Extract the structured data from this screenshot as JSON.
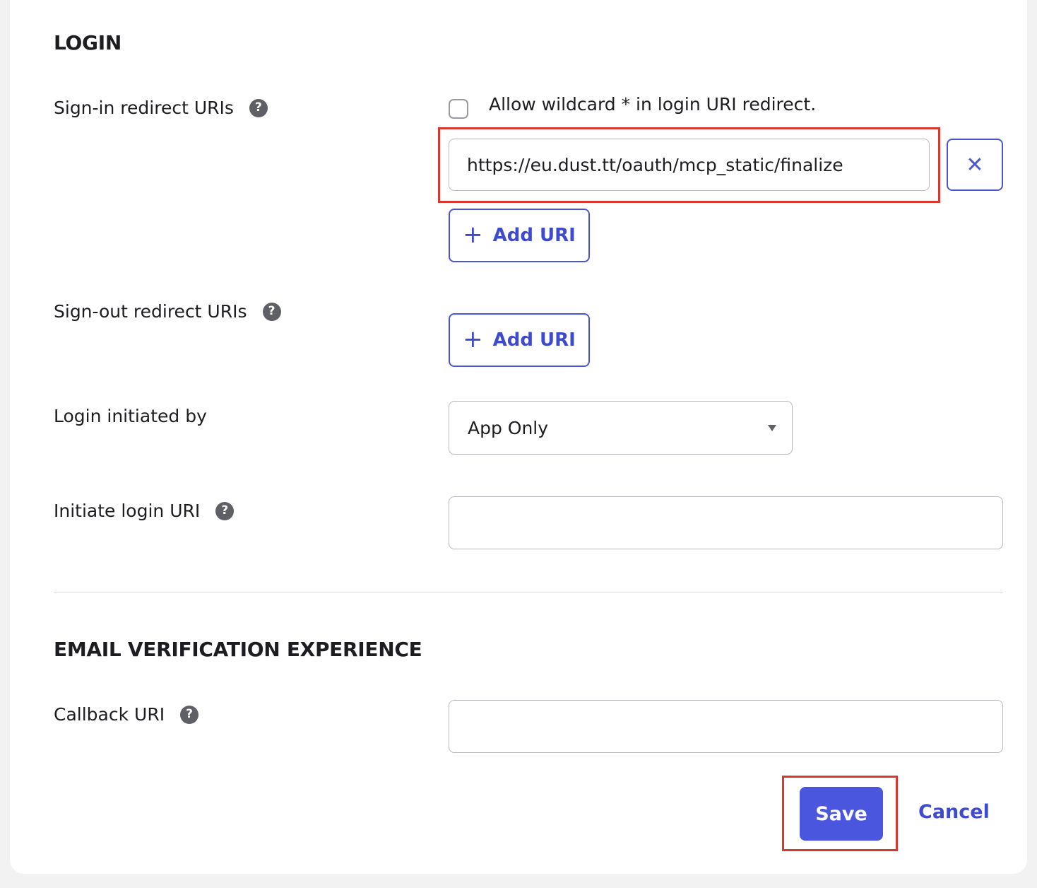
{
  "login_section": {
    "title": "LOGIN",
    "signin": {
      "label": "Sign-in redirect URIs",
      "wildcard_label": "Allow wildcard * in login URI redirect.",
      "uri_value": "https://eu.dust.tt/oauth/mcp_static/finalize",
      "remove_glyph": "✕",
      "add_label": "Add URI"
    },
    "signout": {
      "label": "Sign-out redirect URIs",
      "add_label": "Add URI"
    },
    "login_initiated": {
      "label": "Login initiated by",
      "selected": "App Only"
    },
    "initiate_uri": {
      "label": "Initiate login URI",
      "value": ""
    }
  },
  "email_section": {
    "title": "EMAIL VERIFICATION EXPERIENCE",
    "callback": {
      "label": "Callback URI",
      "value": ""
    }
  },
  "actions": {
    "save_label": "Save",
    "cancel_label": "Cancel"
  },
  "icons": {
    "help": "?",
    "plus": "+"
  },
  "colors": {
    "accent": "#4a56de",
    "highlight": "#d63a2f",
    "help_icon": "#5f5f66"
  }
}
